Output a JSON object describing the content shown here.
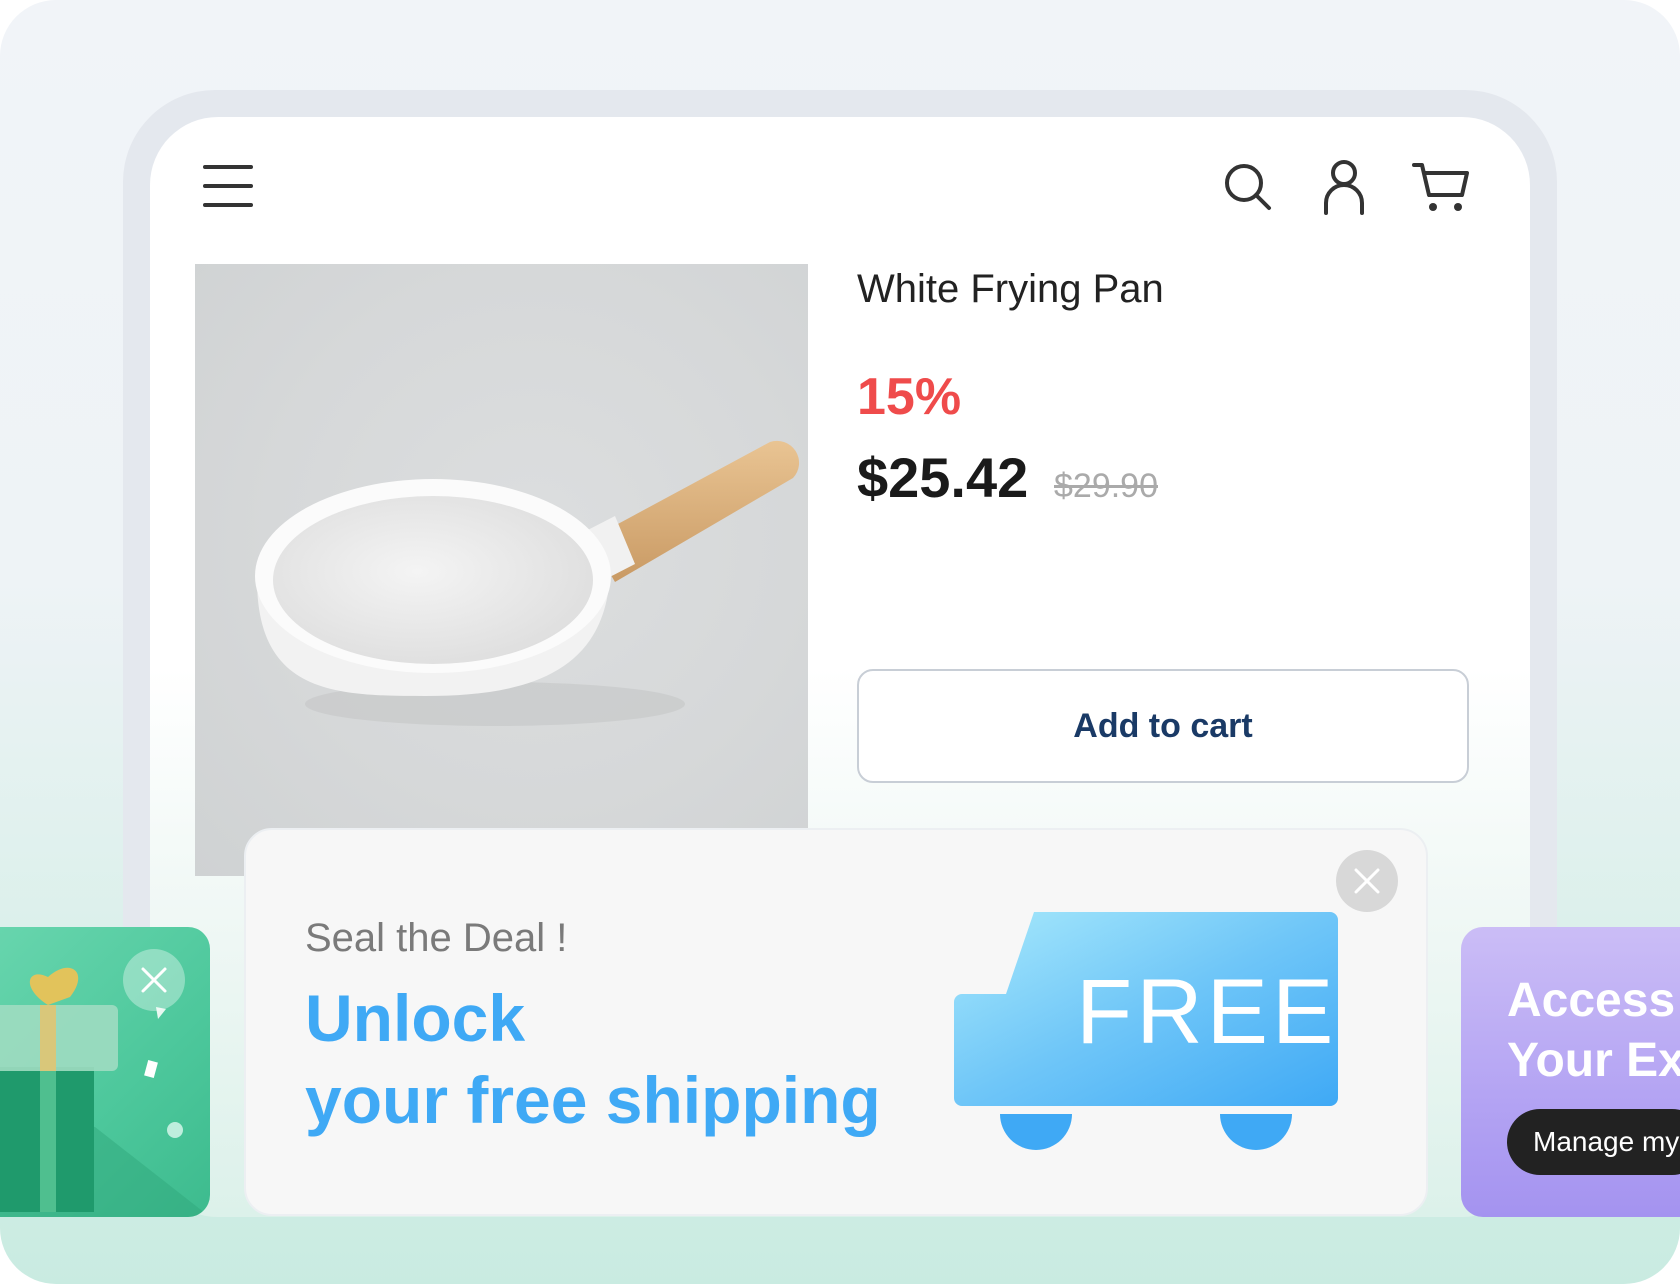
{
  "header": {
    "menu_icon": "hamburger-menu-icon",
    "search_icon": "search-icon",
    "account_icon": "user-icon",
    "cart_icon": "cart-icon"
  },
  "product": {
    "title": "White Frying Pan",
    "discount": "15%",
    "price": "$25.42",
    "original_price": "$29.90",
    "add_to_cart_label": "Add to cart"
  },
  "promo": {
    "subtitle": "Seal the Deal !",
    "headline_line1": "Unlock",
    "headline_line2": "your free shipping",
    "truck_label": "FREE"
  },
  "right_card": {
    "line1": "Access",
    "line2": "Your Ex",
    "button_label": "Manage my"
  },
  "colors": {
    "accent_blue": "#3fa9f5",
    "discount_red": "#ef4b4b",
    "button_text": "#1a3a66",
    "green_card": "#4cc79b",
    "purple_card": "#b3a3f3"
  }
}
